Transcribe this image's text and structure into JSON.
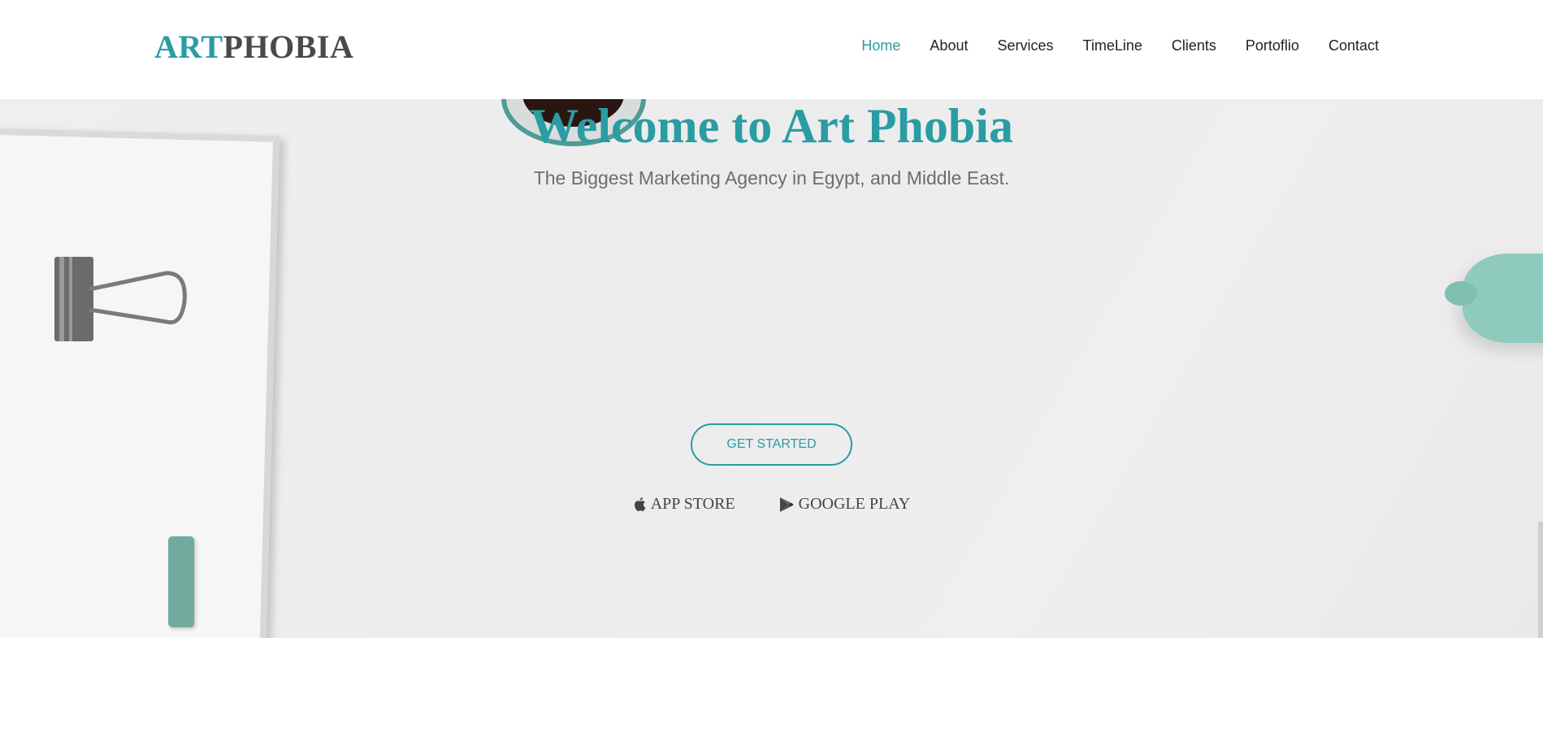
{
  "brand": {
    "accent": "ART",
    "rest": "PHOBIA"
  },
  "nav": {
    "items": [
      "Home",
      "About",
      "Services",
      "TimeLine",
      "Clients",
      "Portoflio",
      "Contact"
    ],
    "active": "Home"
  },
  "hero": {
    "title": "Welcome to Art Phobia",
    "subtitle": "The Biggest Marketing Agency in Egypt, and Middle East.",
    "cta_label": "GET STARTED",
    "stores": [
      {
        "icon": "apple-icon",
        "label": "APP STORE"
      },
      {
        "icon": "google-play-icon",
        "label": "GOOGLE PLAY"
      }
    ]
  },
  "colors": {
    "accent": "#2a9ca3",
    "text": "#222222",
    "subtitle": "#6d6d6d"
  }
}
